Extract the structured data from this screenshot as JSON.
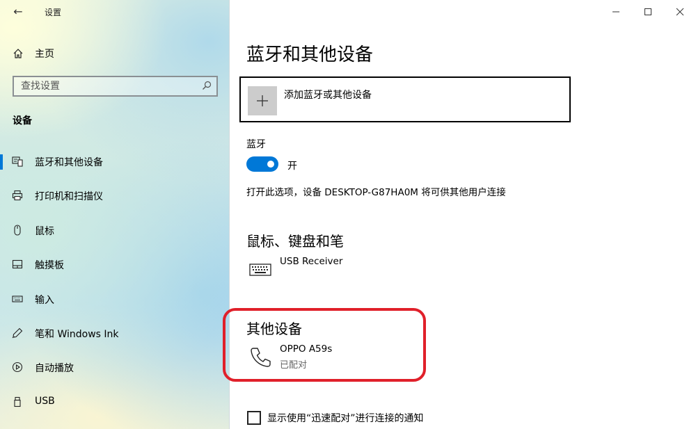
{
  "window": {
    "title": "设置",
    "back_icon": "←"
  },
  "sidebar": {
    "home_label": "主页",
    "search_placeholder": "查找设置",
    "section_title": "设备",
    "items": [
      {
        "label": "蓝牙和其他设备",
        "icon": "bluetooth-devices-icon",
        "selected": true
      },
      {
        "label": "打印机和扫描仪",
        "icon": "printer-icon",
        "selected": false
      },
      {
        "label": "鼠标",
        "icon": "mouse-icon",
        "selected": false
      },
      {
        "label": "触摸板",
        "icon": "touchpad-icon",
        "selected": false
      },
      {
        "label": "输入",
        "icon": "keyboard-icon",
        "selected": false
      },
      {
        "label": "笔和 Windows Ink",
        "icon": "pen-icon",
        "selected": false
      },
      {
        "label": "自动播放",
        "icon": "autoplay-icon",
        "selected": false
      },
      {
        "label": "USB",
        "icon": "usb-icon",
        "selected": false
      }
    ]
  },
  "main": {
    "title": "蓝牙和其他设备",
    "add_device_label": "添加蓝牙或其他设备",
    "bluetooth": {
      "label": "蓝牙",
      "state_label": "开",
      "enabled": true,
      "description": "打开此选项，设备 DESKTOP-G87HA0M 将可供其他用户连接"
    },
    "mouse_keyboard_pen": {
      "title": "鼠标、键盘和笔",
      "devices": [
        {
          "name": "USB Receiver",
          "status": "",
          "icon": "keyboard-icon"
        }
      ]
    },
    "other_devices": {
      "title": "其他设备",
      "devices": [
        {
          "name": "OPPO A59s",
          "status": "已配对",
          "icon": "phone-icon"
        }
      ]
    },
    "swift_pair_checkbox": {
      "label": "显示使用“迅速配对”进行连接的通知",
      "checked": false
    }
  },
  "colors": {
    "accent": "#0078d7",
    "highlight": "#e0202a"
  }
}
